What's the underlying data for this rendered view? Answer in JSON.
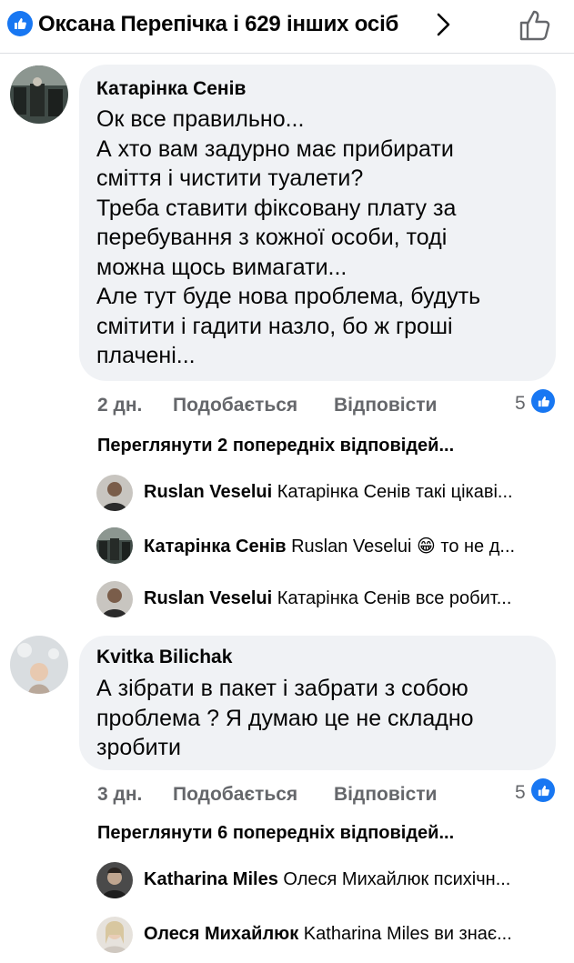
{
  "header": {
    "title": "Оксана Перепічка і 629 інших осіб"
  },
  "comments": [
    {
      "author": "Катарінка Сенів",
      "text": "Ок все правильно...\nА хто вам задурно має прибирати\nсміття і чистити туалети?\nТреба ставити фіксовану плату за\nперебування з кожної особи, тоді\nможна щось вимагати...\nАле тут буде нова проблема, будуть\nсмітити і гадити назло, бо ж гроші\nплачені...",
      "time": "2 дн.",
      "like_label": "Подобається",
      "reply_label": "Відповісти",
      "reactions": "5",
      "view_previous": "Переглянути 2 попередніх відповідей...",
      "replies": [
        {
          "author": "Ruslan Veselui",
          "preview": "Катарінка Сенів такі цікаві..."
        },
        {
          "author": "Катарінка Сенів",
          "preview": "Ruslan Veselui 😁 то не д..."
        },
        {
          "author": "Ruslan Veselui",
          "preview": "Катарінка Сенів все робит..."
        }
      ]
    },
    {
      "author": "Kvitka  Bilichak",
      "text": "А зібрати в пакет і забрати з собою\nпроблема ? Я думаю це не складно\nзробити",
      "time": "3 дн.",
      "like_label": "Подобається",
      "reply_label": "Відповісти",
      "reactions": "5",
      "view_previous": "Переглянути 6 попередніх відповідей...",
      "replies": [
        {
          "author": "Katharina Miles",
          "preview": "Олеся Михайлюк психічн..."
        },
        {
          "author": "Олеся Михайлюк",
          "preview": "Katharina Miles ви знає..."
        }
      ]
    }
  ],
  "colors": {
    "accent": "#1877f2",
    "bubble": "#f0f2f5",
    "meta": "#65676b"
  },
  "icons": [
    "like-badge-icon",
    "chevron-right-icon",
    "thumbs-up-outline-icon"
  ]
}
